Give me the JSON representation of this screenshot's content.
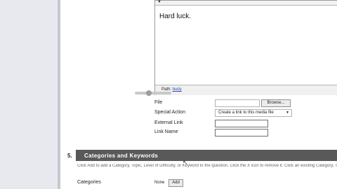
{
  "editor": {
    "content_text": "Hard luck.",
    "status_path_label": "Path:",
    "status_path_value": "body"
  },
  "media": {
    "file_label": "File",
    "browse_label": "Browse...",
    "special_action_label": "Special Action",
    "special_action_value": "Create a link to this media file",
    "external_link_label": "External Link",
    "link_name_label": "Link Name"
  },
  "section5": {
    "number": "5.",
    "title": "Categories and Keywords",
    "description": "Click Add to add a Category, Topic, Level of Difficulty, or Keyword to the question. Click the X icon to remove it. Click an existing Category, Topics, Levels of Difficulty, or Keywords"
  },
  "categories": {
    "label": "Categories",
    "value_text": "None",
    "add_label": "Add"
  }
}
